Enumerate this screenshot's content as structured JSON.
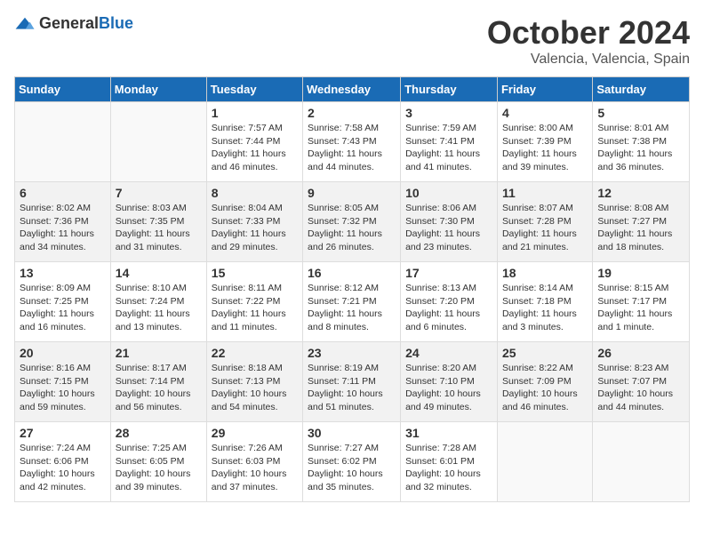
{
  "header": {
    "logo_general": "General",
    "logo_blue": "Blue",
    "title": "October 2024",
    "location": "Valencia, Valencia, Spain"
  },
  "weekdays": [
    "Sunday",
    "Monday",
    "Tuesday",
    "Wednesday",
    "Thursday",
    "Friday",
    "Saturday"
  ],
  "weeks": [
    [
      {
        "date": "",
        "sunrise": "",
        "sunset": "",
        "daylight": ""
      },
      {
        "date": "",
        "sunrise": "",
        "sunset": "",
        "daylight": ""
      },
      {
        "date": "1",
        "sunrise": "Sunrise: 7:57 AM",
        "sunset": "Sunset: 7:44 PM",
        "daylight": "Daylight: 11 hours and 46 minutes."
      },
      {
        "date": "2",
        "sunrise": "Sunrise: 7:58 AM",
        "sunset": "Sunset: 7:43 PM",
        "daylight": "Daylight: 11 hours and 44 minutes."
      },
      {
        "date": "3",
        "sunrise": "Sunrise: 7:59 AM",
        "sunset": "Sunset: 7:41 PM",
        "daylight": "Daylight: 11 hours and 41 minutes."
      },
      {
        "date": "4",
        "sunrise": "Sunrise: 8:00 AM",
        "sunset": "Sunset: 7:39 PM",
        "daylight": "Daylight: 11 hours and 39 minutes."
      },
      {
        "date": "5",
        "sunrise": "Sunrise: 8:01 AM",
        "sunset": "Sunset: 7:38 PM",
        "daylight": "Daylight: 11 hours and 36 minutes."
      }
    ],
    [
      {
        "date": "6",
        "sunrise": "Sunrise: 8:02 AM",
        "sunset": "Sunset: 7:36 PM",
        "daylight": "Daylight: 11 hours and 34 minutes."
      },
      {
        "date": "7",
        "sunrise": "Sunrise: 8:03 AM",
        "sunset": "Sunset: 7:35 PM",
        "daylight": "Daylight: 11 hours and 31 minutes."
      },
      {
        "date": "8",
        "sunrise": "Sunrise: 8:04 AM",
        "sunset": "Sunset: 7:33 PM",
        "daylight": "Daylight: 11 hours and 29 minutes."
      },
      {
        "date": "9",
        "sunrise": "Sunrise: 8:05 AM",
        "sunset": "Sunset: 7:32 PM",
        "daylight": "Daylight: 11 hours and 26 minutes."
      },
      {
        "date": "10",
        "sunrise": "Sunrise: 8:06 AM",
        "sunset": "Sunset: 7:30 PM",
        "daylight": "Daylight: 11 hours and 23 minutes."
      },
      {
        "date": "11",
        "sunrise": "Sunrise: 8:07 AM",
        "sunset": "Sunset: 7:28 PM",
        "daylight": "Daylight: 11 hours and 21 minutes."
      },
      {
        "date": "12",
        "sunrise": "Sunrise: 8:08 AM",
        "sunset": "Sunset: 7:27 PM",
        "daylight": "Daylight: 11 hours and 18 minutes."
      }
    ],
    [
      {
        "date": "13",
        "sunrise": "Sunrise: 8:09 AM",
        "sunset": "Sunset: 7:25 PM",
        "daylight": "Daylight: 11 hours and 16 minutes."
      },
      {
        "date": "14",
        "sunrise": "Sunrise: 8:10 AM",
        "sunset": "Sunset: 7:24 PM",
        "daylight": "Daylight: 11 hours and 13 minutes."
      },
      {
        "date": "15",
        "sunrise": "Sunrise: 8:11 AM",
        "sunset": "Sunset: 7:22 PM",
        "daylight": "Daylight: 11 hours and 11 minutes."
      },
      {
        "date": "16",
        "sunrise": "Sunrise: 8:12 AM",
        "sunset": "Sunset: 7:21 PM",
        "daylight": "Daylight: 11 hours and 8 minutes."
      },
      {
        "date": "17",
        "sunrise": "Sunrise: 8:13 AM",
        "sunset": "Sunset: 7:20 PM",
        "daylight": "Daylight: 11 hours and 6 minutes."
      },
      {
        "date": "18",
        "sunrise": "Sunrise: 8:14 AM",
        "sunset": "Sunset: 7:18 PM",
        "daylight": "Daylight: 11 hours and 3 minutes."
      },
      {
        "date": "19",
        "sunrise": "Sunrise: 8:15 AM",
        "sunset": "Sunset: 7:17 PM",
        "daylight": "Daylight: 11 hours and 1 minute."
      }
    ],
    [
      {
        "date": "20",
        "sunrise": "Sunrise: 8:16 AM",
        "sunset": "Sunset: 7:15 PM",
        "daylight": "Daylight: 10 hours and 59 minutes."
      },
      {
        "date": "21",
        "sunrise": "Sunrise: 8:17 AM",
        "sunset": "Sunset: 7:14 PM",
        "daylight": "Daylight: 10 hours and 56 minutes."
      },
      {
        "date": "22",
        "sunrise": "Sunrise: 8:18 AM",
        "sunset": "Sunset: 7:13 PM",
        "daylight": "Daylight: 10 hours and 54 minutes."
      },
      {
        "date": "23",
        "sunrise": "Sunrise: 8:19 AM",
        "sunset": "Sunset: 7:11 PM",
        "daylight": "Daylight: 10 hours and 51 minutes."
      },
      {
        "date": "24",
        "sunrise": "Sunrise: 8:20 AM",
        "sunset": "Sunset: 7:10 PM",
        "daylight": "Daylight: 10 hours and 49 minutes."
      },
      {
        "date": "25",
        "sunrise": "Sunrise: 8:22 AM",
        "sunset": "Sunset: 7:09 PM",
        "daylight": "Daylight: 10 hours and 46 minutes."
      },
      {
        "date": "26",
        "sunrise": "Sunrise: 8:23 AM",
        "sunset": "Sunset: 7:07 PM",
        "daylight": "Daylight: 10 hours and 44 minutes."
      }
    ],
    [
      {
        "date": "27",
        "sunrise": "Sunrise: 7:24 AM",
        "sunset": "Sunset: 6:06 PM",
        "daylight": "Daylight: 10 hours and 42 minutes."
      },
      {
        "date": "28",
        "sunrise": "Sunrise: 7:25 AM",
        "sunset": "Sunset: 6:05 PM",
        "daylight": "Daylight: 10 hours and 39 minutes."
      },
      {
        "date": "29",
        "sunrise": "Sunrise: 7:26 AM",
        "sunset": "Sunset: 6:03 PM",
        "daylight": "Daylight: 10 hours and 37 minutes."
      },
      {
        "date": "30",
        "sunrise": "Sunrise: 7:27 AM",
        "sunset": "Sunset: 6:02 PM",
        "daylight": "Daylight: 10 hours and 35 minutes."
      },
      {
        "date": "31",
        "sunrise": "Sunrise: 7:28 AM",
        "sunset": "Sunset: 6:01 PM",
        "daylight": "Daylight: 10 hours and 32 minutes."
      },
      {
        "date": "",
        "sunrise": "",
        "sunset": "",
        "daylight": ""
      },
      {
        "date": "",
        "sunrise": "",
        "sunset": "",
        "daylight": ""
      }
    ]
  ]
}
